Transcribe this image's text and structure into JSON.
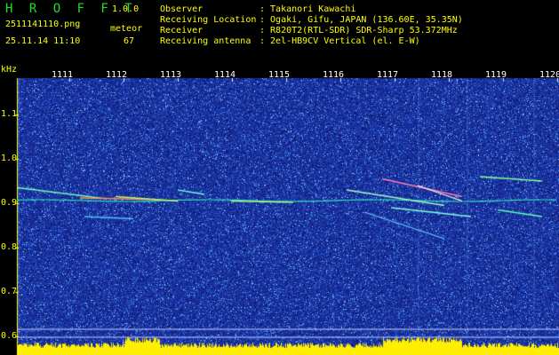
{
  "header": {
    "brand": "H R O F F T",
    "version": "1.0.0",
    "filename": "2511141110.png",
    "datetime": "25.11.14 11:10",
    "counter_label": "meteor",
    "counter_value": "67",
    "info": [
      {
        "label": "Observer",
        "value": ": Takanori Kawachi"
      },
      {
        "label": "Receiving Location",
        "value": ": Ogaki, Gifu, JAPAN (136.60E, 35.35N)"
      },
      {
        "label": "Receiver",
        "value": ": R820T2(RTL-SDR) SDR-Sharp 53.372MHz"
      },
      {
        "label": "Receiving antenna",
        "value": ": 2el-HB9CV Vertical (el. E-W)"
      }
    ]
  },
  "axes": {
    "y_unit": "kHz",
    "y_ticks": [
      "1.1",
      "1.0",
      "0.9",
      "0.8",
      "0.7",
      "0.6"
    ],
    "x_ticks": [
      "1111",
      "1112",
      "1113",
      "1114",
      "1115",
      "1116",
      "1117",
      "1118",
      "1119",
      "1120"
    ]
  },
  "colors": {
    "background": "#000000",
    "plot_bg": "#1a2f9a",
    "label_yellow": "#ffff00",
    "brand_green": "#22dd22",
    "signal_line": "#30e0c0"
  }
}
